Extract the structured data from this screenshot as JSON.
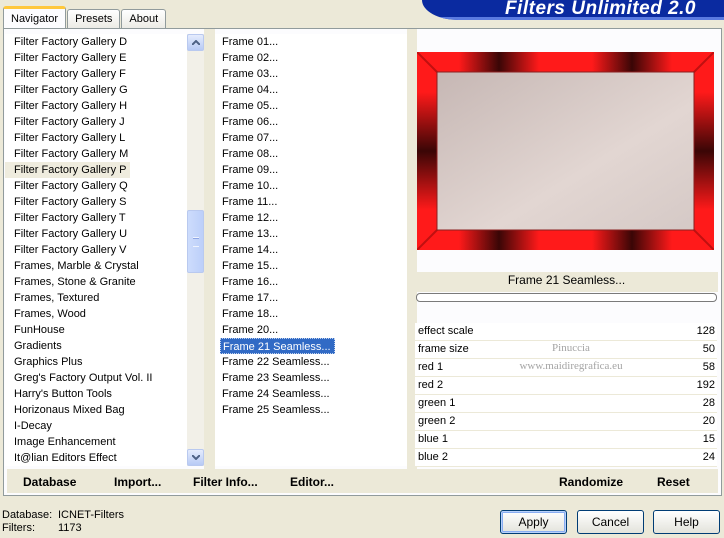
{
  "tabs": [
    "Navigator",
    "Presets",
    "About"
  ],
  "app_title": "Filters Unlimited 2.0",
  "categories": [
    "Filter Factory Gallery D",
    "Filter Factory Gallery E",
    "Filter Factory Gallery F",
    "Filter Factory Gallery G",
    "Filter Factory Gallery H",
    "Filter Factory Gallery J",
    "Filter Factory Gallery L",
    "Filter Factory Gallery M",
    "Filter Factory Gallery P",
    "Filter Factory Gallery Q",
    "Filter Factory Gallery S",
    "Filter Factory Gallery T",
    "Filter Factory Gallery U",
    "Filter Factory Gallery V",
    "Frames, Marble & Crystal",
    "Frames, Stone & Granite",
    "Frames, Textured",
    "Frames, Wood",
    "FunHouse",
    "Gradients",
    "Graphics Plus",
    "Greg's Factory Output Vol. II",
    "Harry's Button Tools",
    "Horizonaus Mixed Bag",
    "I-Decay",
    "Image Enhancement",
    "It@lian Editors Effect"
  ],
  "highlighted_category": "Filter Factory Gallery P",
  "frames": [
    "Frame 01...",
    "Frame 02...",
    "Frame 03...",
    "Frame 04...",
    "Frame 05...",
    "Frame 06...",
    "Frame 07...",
    "Frame 08...",
    "Frame 09...",
    "Frame 10...",
    "Frame 11...",
    "Frame 12...",
    "Frame 13...",
    "Frame 14...",
    "Frame 15...",
    "Frame 16...",
    "Frame 17...",
    "Frame 18...",
    "Frame 20...",
    "Frame 21 Seamless...",
    "Frame 22 Seamless...",
    "Frame 23 Seamless...",
    "Frame 24 Seamless...",
    "Frame 25 Seamless..."
  ],
  "selected_frame": "Frame 21 Seamless...",
  "preview_label": "Frame 21 Seamless...",
  "params": [
    {
      "name": "effect scale",
      "value": "128"
    },
    {
      "name": "frame size",
      "value": "50"
    },
    {
      "name": "red 1",
      "value": "58"
    },
    {
      "name": "red 2",
      "value": "192"
    },
    {
      "name": "green 1",
      "value": "28"
    },
    {
      "name": "green 2",
      "value": "20"
    },
    {
      "name": "blue 1",
      "value": "15"
    },
    {
      "name": "blue 2",
      "value": "24"
    }
  ],
  "watermark": {
    "line1": "Pinuccia",
    "line2": "www.maidiregrafica.eu"
  },
  "toolbar": {
    "database": "Database",
    "import": "Import...",
    "filter_info": "Filter Info...",
    "editor": "Editor...",
    "randomize": "Randomize",
    "reset": "Reset"
  },
  "status": {
    "database_label": "Database:",
    "database_value": "ICNET-Filters",
    "filters_label": "Filters:",
    "filters_value": "1173"
  },
  "buttons": {
    "apply": "Apply",
    "cancel": "Cancel",
    "help": "Help"
  },
  "colors": {
    "frame_red": "#ff1a1a",
    "frame_dark": "#5a0a0a",
    "preview_inner": "#d8cfcb",
    "selection": "#316ac5",
    "banner": "#0a2aa0"
  }
}
